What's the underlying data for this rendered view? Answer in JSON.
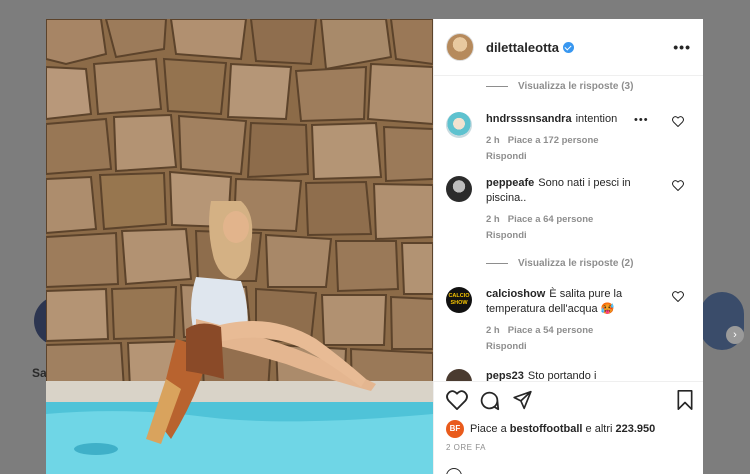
{
  "post": {
    "username": "dilettaleotta",
    "verified": true,
    "more_label": "•••"
  },
  "comments_section": {
    "view_replies_top": "Visualizza le risposte (3)",
    "comments": [
      {
        "username": "hndrsssnsandra",
        "text": "intention",
        "time": "2 h",
        "likes": "Piace a 172 persone",
        "reply": "Rispondi",
        "has_dots": true
      },
      {
        "username": "peppeafe",
        "text": "Sono nati i pesci in piscina..",
        "time": "2 h",
        "likes": "Piace a 64 persone",
        "reply": "Rispondi"
      },
      {
        "username": "calcioshow",
        "text": "È salita pure la temperatura dell'acqua 🥵",
        "time": "2 h",
        "likes": "Piace a 54 persone",
        "reply": "Rispondi",
        "avatar_label": "CALCIO SHOW"
      },
      {
        "username": "peps23",
        "text": "Sto portando i"
      }
    ],
    "view_replies_mid": "Visualizza le risposte (2)"
  },
  "actions": {
    "liked_by_prefix": "Piace a",
    "liked_by_user": "bestoffootball",
    "liked_by_suffix": "e altri",
    "likes_count": "223.950",
    "liker_avatar_label": "BF",
    "time_ago": "2 ORE FA"
  },
  "background": {
    "left_name": "Sa",
    "accent_colors": {
      "verified": "#3897f0",
      "text": "#262626",
      "muted": "#8e8e8e"
    }
  }
}
